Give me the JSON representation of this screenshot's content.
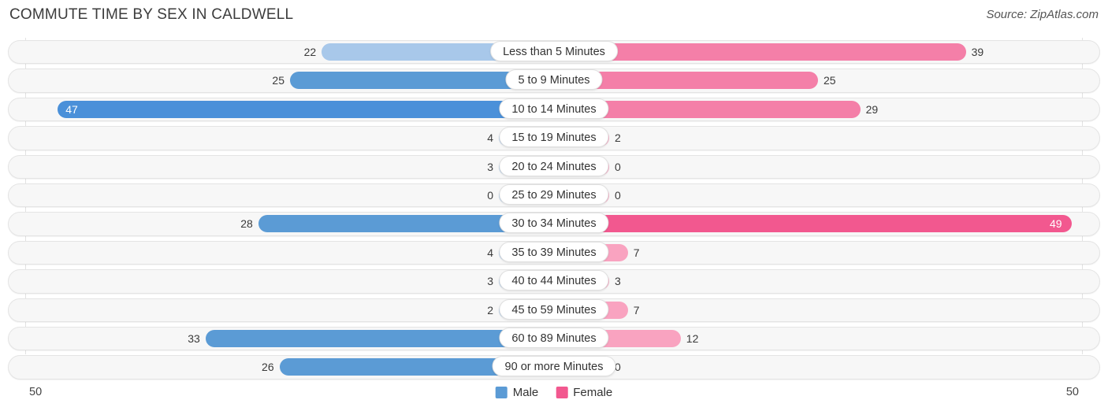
{
  "header": {
    "title": "COMMUTE TIME BY SEX IN CALDWELL",
    "source": "Source: ZipAtlas.com"
  },
  "axis": {
    "left_label": "50",
    "right_label": "50",
    "max": 50
  },
  "legend": {
    "items": [
      {
        "label": "Male",
        "color": "#5b9bd5"
      },
      {
        "label": "Female",
        "color": "#f2588f"
      }
    ]
  },
  "colors": {
    "male_light": "#a8c8ea",
    "male_strong": "#5b9bd5",
    "male_max": "#4a90d9",
    "female_light": "#f9a3c0",
    "female_strong": "#f47fa8",
    "female_max": "#f2588f",
    "track": "#f7f7f7",
    "track_border": "#e4e4e4",
    "title": "#3c3c3c"
  },
  "chart_data": {
    "type": "bar",
    "orientation": "horizontal-diverging",
    "title": "COMMUTE TIME BY SEX IN CALDWELL",
    "xlabel": "",
    "ylabel": "",
    "xlim": [
      50,
      50
    ],
    "grid": true,
    "legend_position": "bottom-center",
    "categories": [
      "Less than 5 Minutes",
      "5 to 9 Minutes",
      "10 to 14 Minutes",
      "15 to 19 Minutes",
      "20 to 24 Minutes",
      "25 to 29 Minutes",
      "30 to 34 Minutes",
      "35 to 39 Minutes",
      "40 to 44 Minutes",
      "45 to 59 Minutes",
      "60 to 89 Minutes",
      "90 or more Minutes"
    ],
    "series": [
      {
        "name": "Male",
        "values": [
          22,
          25,
          47,
          4,
          3,
          0,
          28,
          4,
          3,
          2,
          33,
          26
        ]
      },
      {
        "name": "Female",
        "values": [
          39,
          25,
          29,
          2,
          0,
          0,
          49,
          7,
          3,
          7,
          12,
          0
        ]
      }
    ]
  },
  "rows": [
    {
      "category": "Less than 5 Minutes",
      "male": 22,
      "female": 39
    },
    {
      "category": "5 to 9 Minutes",
      "male": 25,
      "female": 25
    },
    {
      "category": "10 to 14 Minutes",
      "male": 47,
      "female": 29
    },
    {
      "category": "15 to 19 Minutes",
      "male": 4,
      "female": 2
    },
    {
      "category": "20 to 24 Minutes",
      "male": 3,
      "female": 0
    },
    {
      "category": "25 to 29 Minutes",
      "male": 0,
      "female": 0
    },
    {
      "category": "30 to 34 Minutes",
      "male": 28,
      "female": 49
    },
    {
      "category": "35 to 39 Minutes",
      "male": 4,
      "female": 7
    },
    {
      "category": "40 to 44 Minutes",
      "male": 3,
      "female": 3
    },
    {
      "category": "45 to 59 Minutes",
      "male": 2,
      "female": 7
    },
    {
      "category": "60 to 89 Minutes",
      "male": 33,
      "female": 12
    },
    {
      "category": "90 or more Minutes",
      "male": 26,
      "female": 0
    }
  ]
}
